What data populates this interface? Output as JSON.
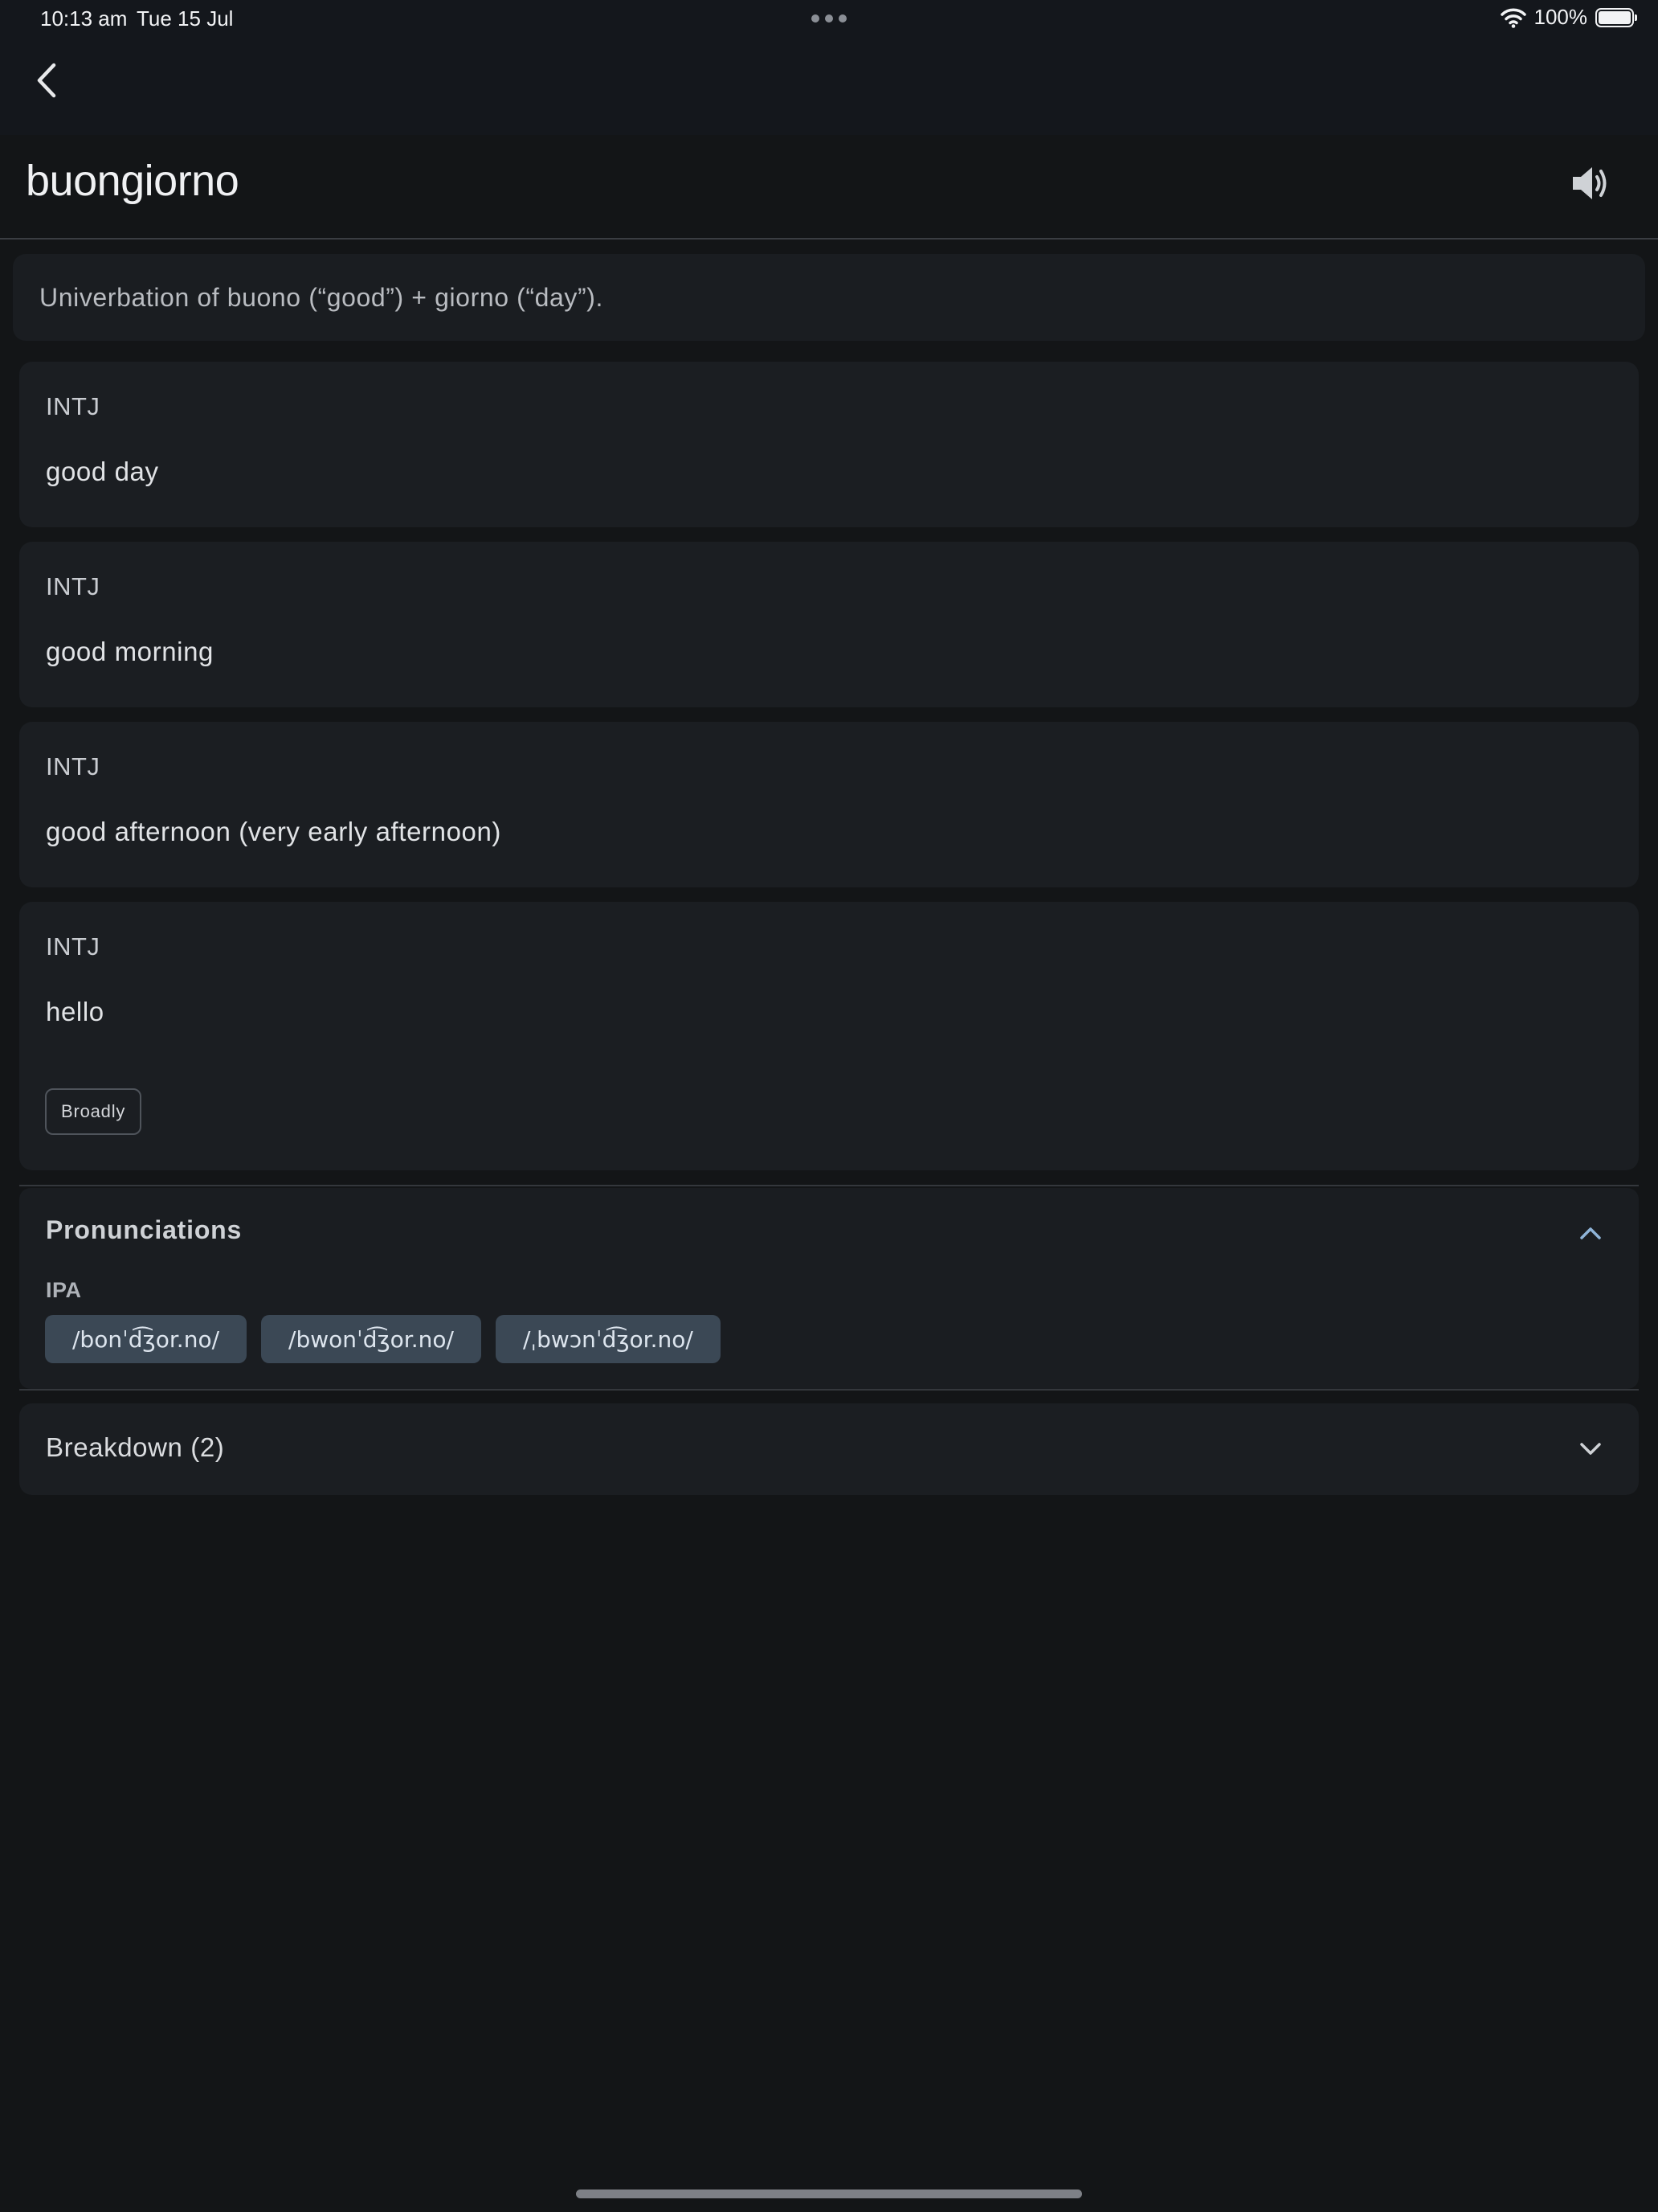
{
  "status_bar": {
    "time": "10:13 am",
    "date": "Tue 15 Jul",
    "battery": "100%"
  },
  "header": {
    "back_icon": "chevron-left-icon",
    "title": "buongiorno",
    "speaker_icon": "speaker-icon"
  },
  "etymology": "Univerbation of buono (“good”) + giorno (“day”).",
  "senses": [
    {
      "pos": "INTJ",
      "gloss": "good day"
    },
    {
      "pos": "INTJ",
      "gloss": "good morning"
    },
    {
      "pos": "INTJ",
      "gloss": "good afternoon (very early afternoon)"
    },
    {
      "pos": "INTJ",
      "gloss": "hello",
      "tag": "Broadly"
    }
  ],
  "pronunciations": {
    "title": "Pronunciations",
    "ipa_label": "IPA",
    "ipa": [
      "/bonˈd͡ʒor.no/",
      "/bwonˈd͡ʒor.no/",
      "/ˌbwɔnˈd͡ʒor.no/"
    ],
    "expanded": true
  },
  "breakdown": {
    "label": "Breakdown (2)",
    "expanded": false
  },
  "colors": {
    "background": "#131517",
    "card": "#1b1e22",
    "chip": "#3b4855",
    "accent": "#8fb4d8"
  }
}
